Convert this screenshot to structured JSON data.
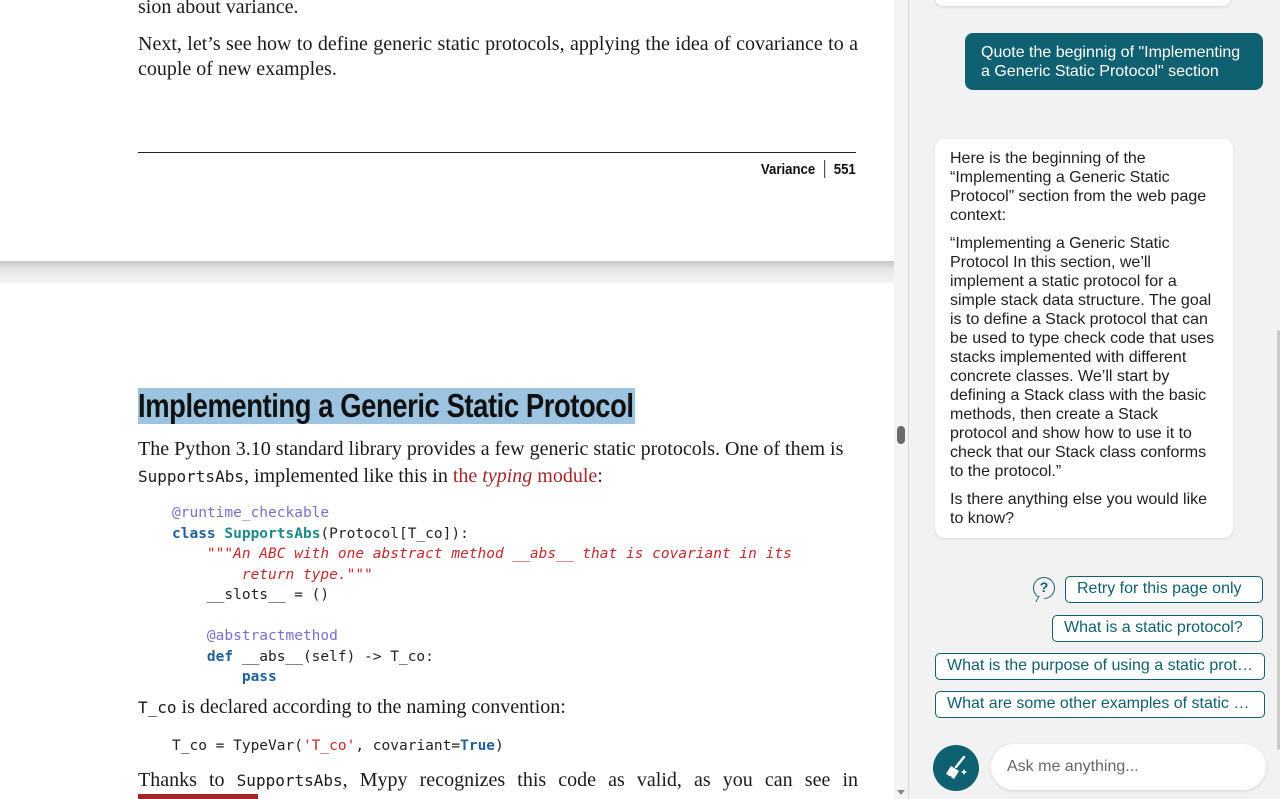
{
  "document": {
    "prev_page_tail": "sion about variance.",
    "next_paragraph": "Next, let’s see how to define generic static protocols, applying the idea of covariance to a couple of new examples.",
    "footer": {
      "section": "Variance",
      "page": "551"
    },
    "heading": "Implementing a Generic Static Protocol",
    "intro": {
      "part1": "The Python 3.10 standard library provides a few generic static protocols. One of them is ",
      "code": "SupportsAbs",
      "part2": ", implemented like this in ",
      "link_prefix": "the ",
      "link_italic": "typing",
      "link_suffix": " module",
      "end": ":"
    },
    "code_block": {
      "l1_decorator": "@runtime_checkable",
      "l2_kw": "class",
      "l2_cls": "SupportsAbs",
      "l2_rest": "(Protocol[T_co]):",
      "l3_doc": "    \"\"\"An ABC with one abstract method __abs__ that is covariant in its",
      "l4_doc": "        return type.\"\"\"",
      "l5_slots": "    __slots__ = ()",
      "l7_decorator": "    @abstractmethod",
      "l8_kw": "    def",
      "l8_rest": " __abs__(self) -> T_co:",
      "l9_pass": "        pass"
    },
    "tco_sentence": {
      "code": "T_co",
      "text": " is declared according to the naming convention:"
    },
    "code_line2": {
      "lhs": "T_co = TypeVar(",
      "str": "'T_co'",
      "mid": ", covariant=",
      "kw": "True",
      "end": ")"
    },
    "thanks_sentence": {
      "pre": "Thanks to ",
      "code": "SupportsAbs",
      "post": ", Mypy recognizes this code as valid, as you can see in"
    }
  },
  "chat": {
    "user_message": "Quote the beginnig of \"Implementing a Generic Static Protocol\" section",
    "bot_intro": "Here is the beginning of the “Implementing a Generic Static Protocol” section from the web page context:",
    "bot_quote": "“Implementing a Generic Static Protocol In this section, we’ll implement a static protocol for a simple stack data structure. The goal is to define a Stack protocol that can be used to type check code that uses stacks implemented with different concrete classes. We’ll start by defining a Stack class with the basic methods, then create a Stack protocol and show how to use it to check that our Stack class conforms to the protocol.”",
    "bot_followup": "Is there anything else you would like to know?",
    "help_icon_glyph": "?",
    "suggestions": [
      "Retry for this page only",
      "What is a static protocol?",
      "What is the purpose of using a static protocol?",
      "What are some other examples of static protocols?"
    ],
    "input_placeholder": "Ask me anything...",
    "accent_color": "#0f6071"
  }
}
